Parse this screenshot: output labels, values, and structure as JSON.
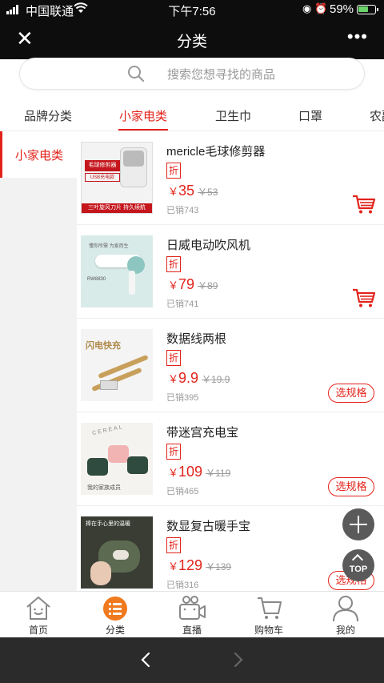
{
  "status_bar": {
    "carrier": "中国联通",
    "time": "下午7:56",
    "battery_pct": "59%"
  },
  "header": {
    "title": "分类"
  },
  "search": {
    "placeholder": "搜索您想寻找的商品"
  },
  "tabs": [
    "品牌分类",
    "小家电类",
    "卫生巾",
    "口罩",
    "农副"
  ],
  "active_tab": "小家电类",
  "sidebar": {
    "active": "小家电类"
  },
  "products": [
    {
      "name": "mericle毛球修剪器",
      "badge": "折",
      "currency": "￥",
      "price": "35",
      "old_price": "￥53",
      "sold": "已销743",
      "action": "cart",
      "thumb_text": [
        "毛球修剪器",
        "USB充电款",
        "三叶旋风刀片 持久续航"
      ]
    },
    {
      "name": "日威电动吹风机",
      "badge": "折",
      "currency": "￥",
      "price": "79",
      "old_price": "￥89",
      "sold": "已销741",
      "action": "cart",
      "thumb_text": [
        "懂你所需 为爱而生",
        "RW8830"
      ]
    },
    {
      "name": "数据线两根",
      "badge": "折",
      "currency": "￥",
      "price": "9.9",
      "old_price": "￥19.9",
      "sold": "已销395",
      "action": "选规格",
      "thumb_text": [
        "闪电快充"
      ]
    },
    {
      "name": "带迷宫充电宝",
      "badge": "折",
      "currency": "￥",
      "price": "109",
      "old_price": "￥119",
      "sold": "已销465",
      "action": "选规格",
      "thumb_text": [
        "CEREAL",
        "我的家族成员"
      ]
    },
    {
      "name": "数显复古暖手宝",
      "badge": "折",
      "currency": "￥",
      "price": "129",
      "old_price": "￥139",
      "sold": "已销316",
      "action": "选规格",
      "thumb_text": [
        "捧在手心里的温暖"
      ]
    }
  ],
  "floating": {
    "top_label": "TOP"
  },
  "tabbar": [
    {
      "label": "首页",
      "icon": "home-icon",
      "active": false
    },
    {
      "label": "分类",
      "icon": "category-icon",
      "active": true
    },
    {
      "label": "直播",
      "icon": "video-camera-icon",
      "active": false
    },
    {
      "label": "购物车",
      "icon": "cart-icon",
      "active": false
    },
    {
      "label": "我的",
      "icon": "user-icon",
      "active": false
    }
  ],
  "colors": {
    "accent": "#e2231a",
    "tabbar_active": "#f07a1f",
    "dark_bar": "#0d0d0d"
  }
}
